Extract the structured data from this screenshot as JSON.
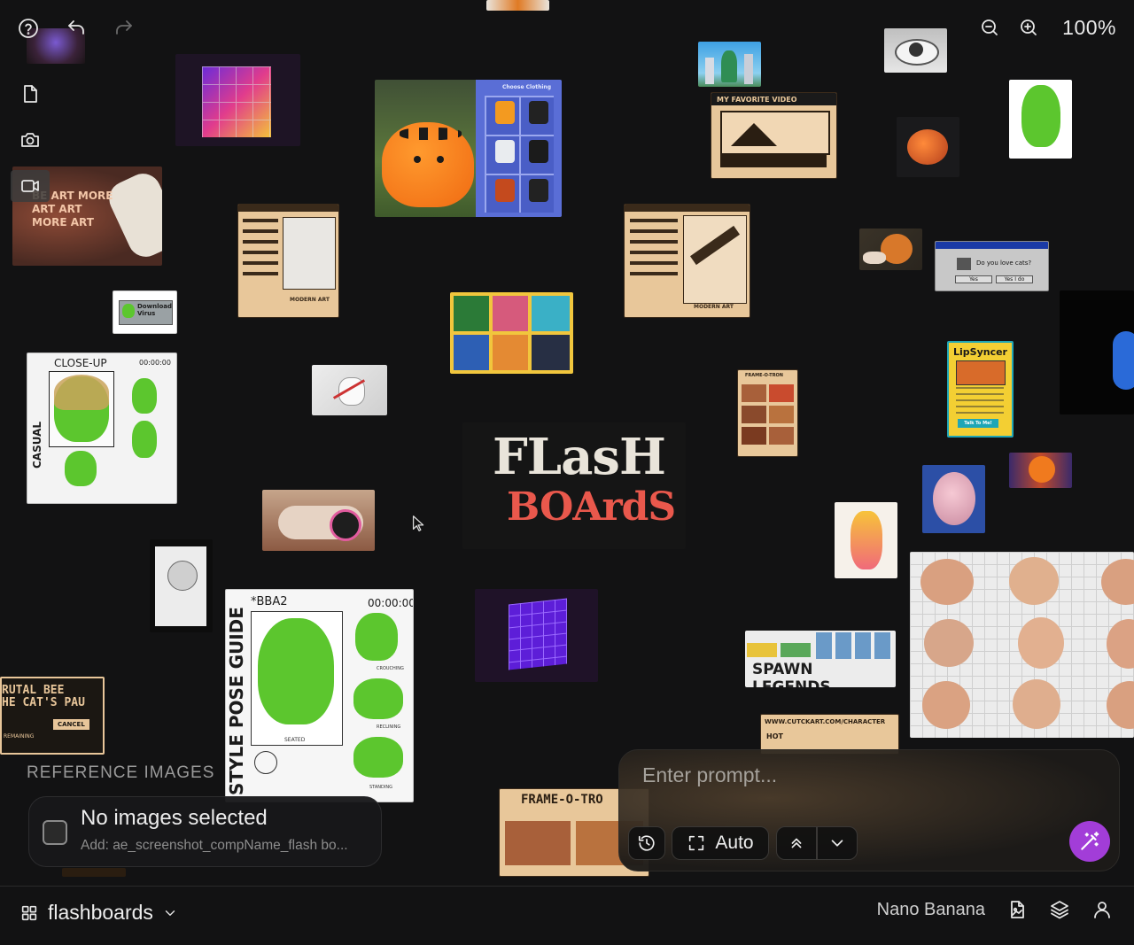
{
  "toolbar": {
    "zoom": "100%"
  },
  "canvas": {
    "close_up_label": "CLOSE-UP",
    "close_up_time": "00:00:00",
    "casual_label": "CASUAL",
    "style_pose_title": "STYLE POSE GUIDE",
    "style_pose_code": "*BBA2",
    "style_pose_time": "00:00:00",
    "style_pose_seated": "SEATED",
    "style_pose_crouching": "CROUCHING",
    "style_pose_reclining": "RECLINING",
    "style_pose_standing": "STANDING",
    "choose_clothing": "Choose Clothing",
    "my_favorite_video": "MY FAVORITE VIDEO",
    "logo_line1": "FLasH",
    "logo_line2": "BOArdS",
    "spawn_legends": "SPAWN LEGENDS",
    "frame_o_tron": "FRAME-O-TRO",
    "frame_o_tron_small": "FRAME-O-TRON",
    "lipsyncer": "LipSyncer",
    "talk_to_me": "Talk To Me!",
    "download_virus": "Download Virus",
    "do_you_love_cats": "Do you love cats?",
    "dialog_yes": "Yes",
    "dialog_yes_i_do": "Yes I do",
    "brutal_bee_line1": "RUTAL BEE",
    "brutal_bee_line2": "HE CAT'S PAU",
    "cancel": "CANCEL",
    "remaining": "REMAINING",
    "art_text": "BE ART MORE ART ART MORE ART",
    "modern_art": "MODERN ART",
    "cutckart": "WWW.CUTCKART.COM/CHARACTER",
    "hot": "HOT"
  },
  "reference": {
    "title": "REFERENCE IMAGES",
    "status": "No images selected",
    "hint": "Add: ae_screenshot_compName_flash bo..."
  },
  "prompt": {
    "placeholder": "Enter prompt...",
    "mode": "Auto"
  },
  "bottom": {
    "project": "flashboards",
    "model": "Nano Banana"
  },
  "colors": {
    "accent": "#a23dd8",
    "background": "#121213"
  }
}
